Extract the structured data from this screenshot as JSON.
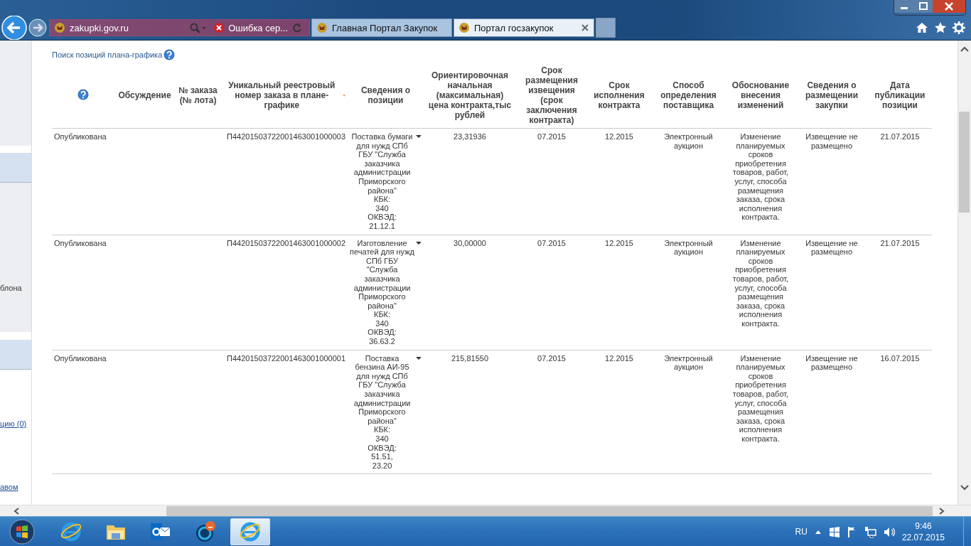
{
  "browser": {
    "address": "zakupki.gov.ru",
    "tabs": [
      {
        "title": "Ошибка сер...",
        "kind": "error",
        "selected": false
      },
      {
        "title": "Главная Портал Закупок",
        "kind": "emblem",
        "selected": false
      },
      {
        "title": "Портал госзакупок",
        "kind": "emblem",
        "selected": true
      }
    ]
  },
  "sidebar": {
    "items": [
      {
        "text": "блона",
        "kind": "text"
      },
      {
        "text": "цию (0)",
        "kind": "link"
      },
      {
        "text": "авом",
        "kind": "link"
      }
    ]
  },
  "page": {
    "search_link": "Поиск позиций плана-графика",
    "table": {
      "columns": [
        {
          "kind": "help"
        },
        {
          "label": "Обсуждение",
          "kind": "text",
          "sorted": false
        },
        {
          "label": "№ заказа (№ лота)",
          "kind": "text",
          "sorted": false
        },
        {
          "label": "Уникальный реестровый номер заказа в плане-графике",
          "kind": "text",
          "sorted": true
        },
        {
          "label": "Сведения о позиции",
          "kind": "text",
          "sorted": false
        },
        {
          "label": "Ориентировочная начальная (максимальная) цена контракта,тыс рублей",
          "kind": "text",
          "sorted": false
        },
        {
          "label": "Срок размещения извещения (срок заключения контракта)",
          "kind": "text",
          "sorted": false
        },
        {
          "label": "Срок исполнения контракта",
          "kind": "text",
          "sorted": false
        },
        {
          "label": "Способ определения поставщика",
          "kind": "text",
          "sorted": false
        },
        {
          "label": "Обоснование внесения изменений",
          "kind": "text",
          "sorted": false
        },
        {
          "label": "Сведения о размещении закупки",
          "kind": "text",
          "sorted": false
        },
        {
          "label": "Дата публикации позиции",
          "kind": "text",
          "sorted": false
        }
      ],
      "rows": [
        {
          "status": "Опубликована",
          "number": "П44201503722001463001000003",
          "description": "Поставка бумаги для нужд СПб ГБУ \"Служба заказчика администрации Приморского района\"\nКБК:\n340\nОКВЭД:\n21.12.1",
          "price": "23,31936",
          "placement_term": "07.2015",
          "execution_term": "12.2015",
          "method": "Электронный аукцион",
          "justification": "Изменение планируемых сроков приобретения товаров, работ, услуг, способа размещения заказа, срока исполнения контракта.",
          "placement_info": "Извещение не размещено",
          "published": "21.07.2015"
        },
        {
          "status": "Опубликована",
          "number": "П44201503722001463001000002",
          "description": "Изготовление печатей для нужд СПб ГБУ \"Служба заказчика администрации Приморского района\"\nКБК:\n340\nОКВЭД:\n36.63.2",
          "price": "30,00000",
          "placement_term": "07.2015",
          "execution_term": "12.2015",
          "method": "Электронный аукцион",
          "justification": "Изменение планируемых сроков приобретения товаров, работ, услуг, способа размещения заказа, срока исполнения контракта.",
          "placement_info": "Извещение не размещено",
          "published": "21.07.2015"
        },
        {
          "status": "Опубликована",
          "number": "П44201503722001463001000001",
          "description": "Поставка бензина АИ-95 для нужд СПб ГБУ \"Служба заказчика администрации Приморского района\"\nКБК:\n340\nОКВЭД:\n51.51,\n23.20",
          "price": "215,81550",
          "placement_term": "07.2015",
          "execution_term": "12.2015",
          "method": "Электронный аукцион",
          "justification": "Изменение планируемых сроков приобретения товаров, работ, услуг, способа размещения заказа, срока исполнения контракта.",
          "placement_info": "Извещение не размещено",
          "published": "16.07.2015"
        }
      ]
    }
  },
  "taskbar": {
    "apps": [
      {
        "kind": "ie",
        "selected": false
      },
      {
        "kind": "folder",
        "selected": false
      },
      {
        "kind": "mail",
        "selected": false
      },
      {
        "kind": "chat",
        "selected": false
      },
      {
        "kind": "ie",
        "selected": true
      }
    ],
    "language": "RU",
    "time": "9:46",
    "date": "22.07.2015"
  }
}
